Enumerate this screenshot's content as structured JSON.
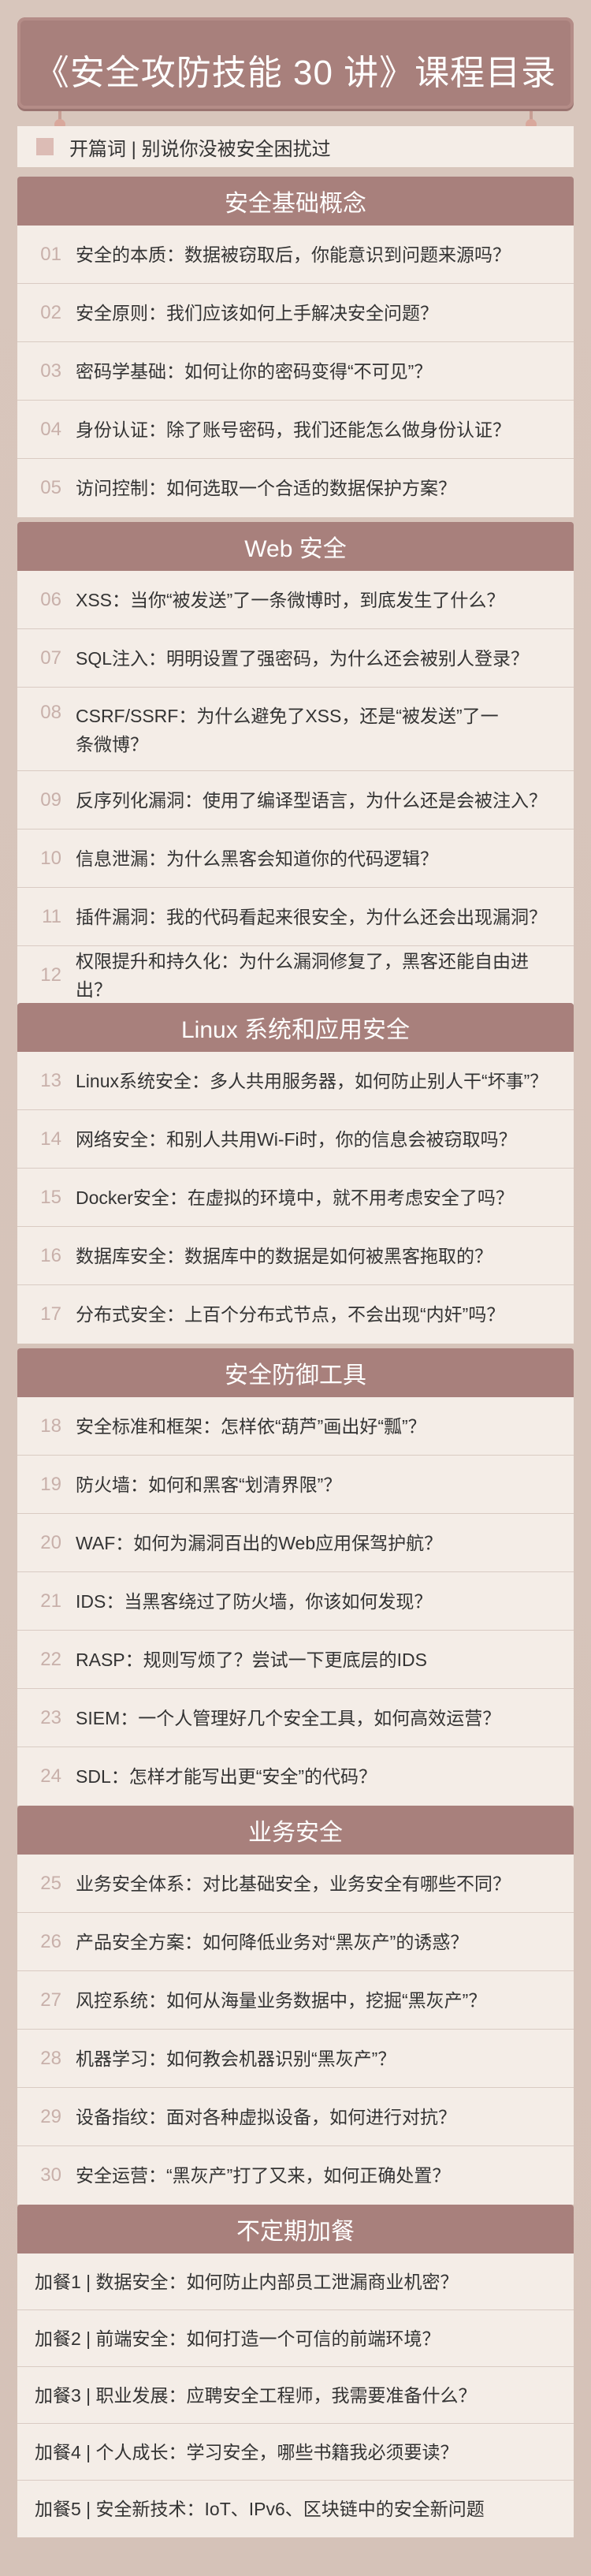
{
  "course_title": "《安全攻防技能 30 讲》课程目录",
  "preface": "开篇词 | 别说你没被安全困扰过",
  "sections": [
    {
      "title": "安全基础概念",
      "items": [
        {
          "num": "01",
          "text": "安全的本质：数据被窃取后，你能意识到问题来源吗？"
        },
        {
          "num": "02",
          "text": "安全原则：我们应该如何上手解决安全问题？"
        },
        {
          "num": "03",
          "text": "密码学基础：如何让你的密码变得“不可见”？"
        },
        {
          "num": "04",
          "text": "身份认证：除了账号密码，我们还能怎么做身份认证？"
        },
        {
          "num": "05",
          "text": "访问控制：如何选取一个合适的数据保护方案？"
        }
      ]
    },
    {
      "title": "Web 安全",
      "items": [
        {
          "num": "06",
          "text": "XSS：当你“被发送”了一条微博时，到底发生了什么？"
        },
        {
          "num": "07",
          "text": "SQL注入：明明设置了强密码，为什么还会被别人登录？"
        },
        {
          "num": "08",
          "text": "CSRF/SSRF：为什么避免了XSS，还是“被发送”了一条微博？"
        },
        {
          "num": "09",
          "text": "反序列化漏洞：使用了编译型语言，为什么还是会被注入？"
        },
        {
          "num": "10",
          "text": "信息泄漏：为什么黑客会知道你的代码逻辑？"
        },
        {
          "num": "11",
          "text": "插件漏洞：我的代码看起来很安全，为什么还会出现漏洞？"
        },
        {
          "num": "12",
          "text": "权限提升和持久化：为什么漏洞修复了，黑客还能自由进出？"
        }
      ]
    },
    {
      "title": "Linux 系统和应用安全",
      "items": [
        {
          "num": "13",
          "text": "Linux系统安全：多人共用服务器，如何防止别人干“坏事”？"
        },
        {
          "num": "14",
          "text": "网络安全：和别人共用Wi-Fi时，你的信息会被窃取吗？"
        },
        {
          "num": "15",
          "text": "Docker安全：在虚拟的环境中，就不用考虑安全了吗？"
        },
        {
          "num": "16",
          "text": "数据库安全：数据库中的数据是如何被黑客拖取的？"
        },
        {
          "num": "17",
          "text": "分布式安全：上百个分布式节点，不会出现“内奸”吗？"
        }
      ]
    },
    {
      "title": "安全防御工具",
      "items": [
        {
          "num": "18",
          "text": "安全标准和框架：怎样依“葫芦”画出好“瓢”？"
        },
        {
          "num": "19",
          "text": "防火墙：如何和黑客“划清界限”？"
        },
        {
          "num": "20",
          "text": "WAF：如何为漏洞百出的Web应用保驾护航？"
        },
        {
          "num": "21",
          "text": "IDS：当黑客绕过了防火墙，你该如何发现？"
        },
        {
          "num": "22",
          "text": "RASP：规则写烦了？尝试一下更底层的IDS"
        },
        {
          "num": "23",
          "text": "SIEM：一个人管理好几个安全工具，如何高效运营？"
        },
        {
          "num": "24",
          "text": "SDL：怎样才能写出更“安全”的代码？"
        }
      ]
    },
    {
      "title": "业务安全",
      "items": [
        {
          "num": "25",
          "text": "业务安全体系：对比基础安全，业务安全有哪些不同？"
        },
        {
          "num": "26",
          "text": "产品安全方案：如何降低业务对“黑灰产”的诱惑？"
        },
        {
          "num": "27",
          "text": "风控系统：如何从海量业务数据中，挖掘“黑灰产”？"
        },
        {
          "num": "28",
          "text": "机器学习：如何教会机器识别“黑灰产”？"
        },
        {
          "num": "29",
          "text": "设备指纹：面对各种虚拟设备，如何进行对抗？"
        },
        {
          "num": "30",
          "text": "安全运营：“黑灰产”打了又来，如何正确处置？"
        }
      ]
    }
  ],
  "extra": {
    "title": "不定期加餐",
    "items": [
      "加餐1 | 数据安全：如何防止内部员工泄漏商业机密？",
      "加餐2 | 前端安全：如何打造一个可信的前端环境？",
      "加餐3 | 职业发展：应聘安全工程师，我需要准备什么？",
      "加餐4 | 个人成长：学习安全，哪些书籍我必须要读？",
      "加餐5 | 安全新技术：IoT、IPv6、区块链中的安全新问题"
    ]
  },
  "colors": {
    "background": "#d5c2b8",
    "banner": "#a8807c",
    "row": "#f4ede7",
    "number": "#c8b0aa"
  }
}
